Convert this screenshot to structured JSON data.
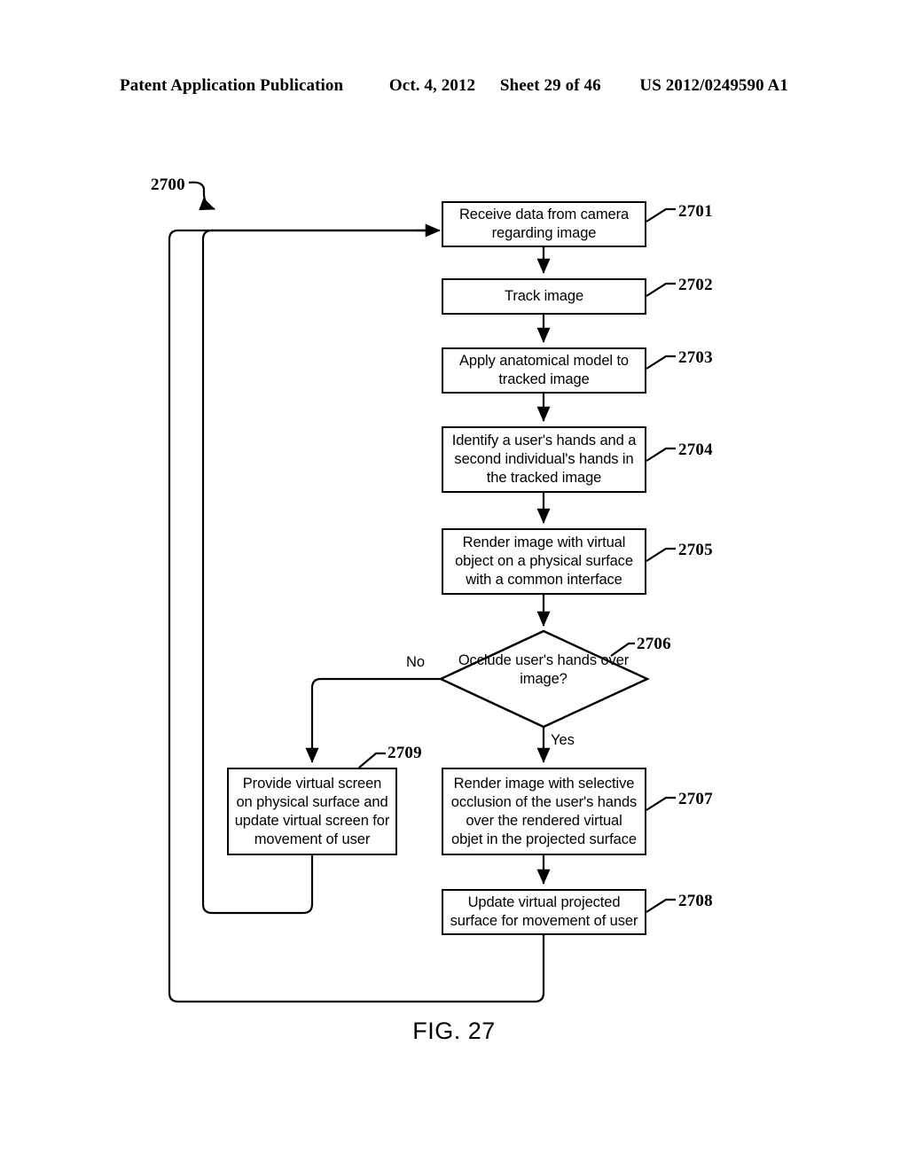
{
  "header": {
    "publication": "Patent Application Publication",
    "date": "Oct. 4, 2012",
    "sheet": "Sheet 29 of 46",
    "patent_number": "US 2012/0249590 A1"
  },
  "figure": {
    "caption": "FIG. 27",
    "diagram_label": "2700"
  },
  "flowchart": {
    "nodes": [
      {
        "ref": "2701",
        "type": "process",
        "text": "Receive data from camera regarding image"
      },
      {
        "ref": "2702",
        "type": "process",
        "text": "Track image"
      },
      {
        "ref": "2703",
        "type": "process",
        "text": "Apply anatomical model to tracked image"
      },
      {
        "ref": "2704",
        "type": "process",
        "text": "Identify a user's hands and a second individual's hands in the tracked image"
      },
      {
        "ref": "2705",
        "type": "process",
        "text": "Render image with virtual object on a physical surface with a common interface"
      },
      {
        "ref": "2706",
        "type": "decision",
        "text": "Occlude user's hands over image?"
      },
      {
        "ref": "2707",
        "type": "process",
        "text": "Render image with selective occlusion of the user's hands over the rendered virtual objet in the projected surface"
      },
      {
        "ref": "2708",
        "type": "process",
        "text": "Update virtual projected surface for movement of user"
      },
      {
        "ref": "2709",
        "type": "process",
        "text": "Provide virtual screen on physical surface and update virtual screen for movement of user"
      }
    ],
    "branches": {
      "no": "No",
      "yes": "Yes"
    }
  }
}
